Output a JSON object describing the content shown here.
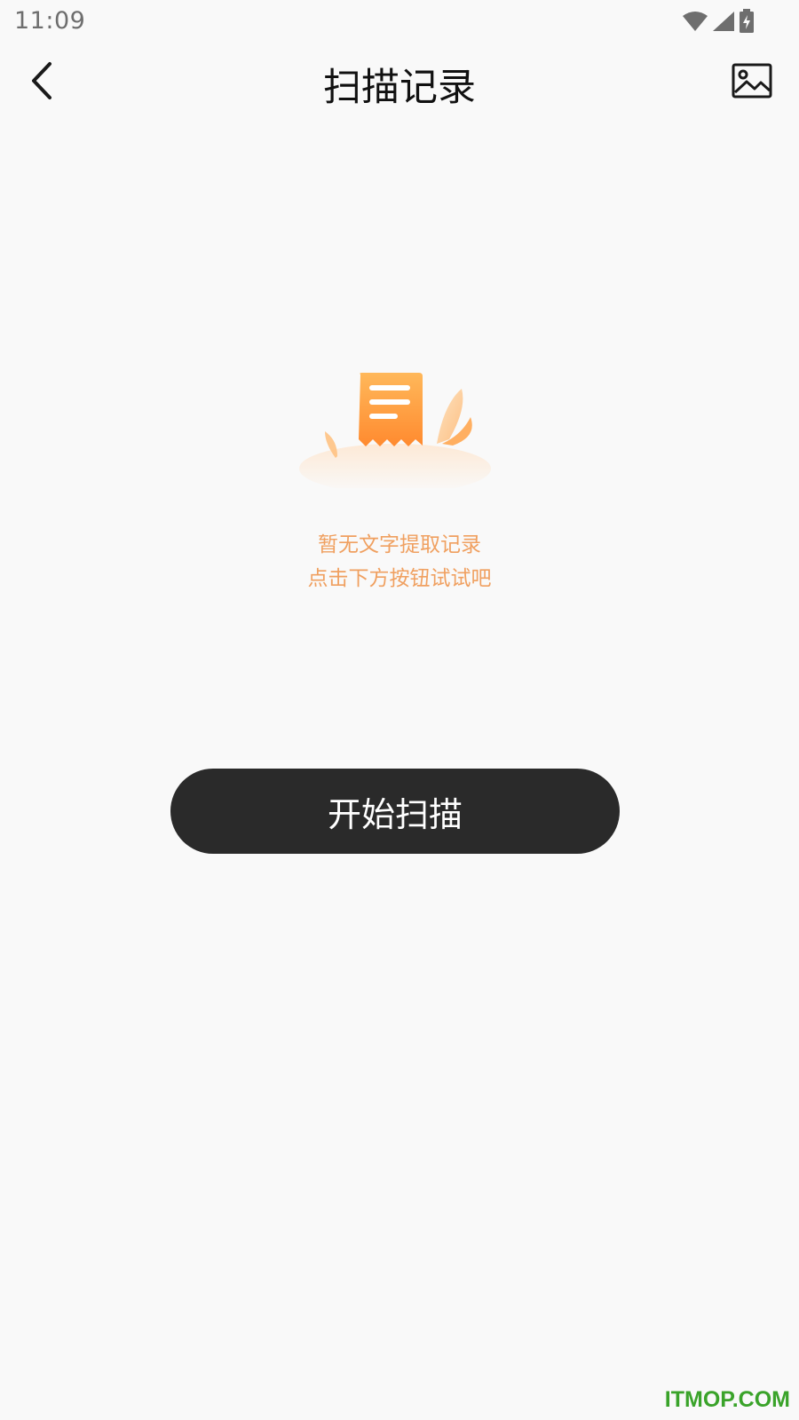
{
  "status_bar": {
    "time": "11:09",
    "icons": [
      "wifi-icon",
      "signal-icon",
      "battery-charging-icon"
    ]
  },
  "app_bar": {
    "back_icon": "chevron-left-icon",
    "title": "扫描记录",
    "gallery_icon": "image-icon"
  },
  "empty_state": {
    "illustration": "receipt-illustration",
    "line1": "暂无文字提取记录",
    "line2": "点击下方按钮试试吧"
  },
  "actions": {
    "start_scan_label": "开始扫描"
  },
  "watermark": {
    "text": "ITMOP.COM"
  },
  "colors": {
    "background": "#f9f9f9",
    "accent_orange": "#f0a060",
    "button_dark": "#2a2a2a",
    "watermark_green": "#3aa32a"
  }
}
